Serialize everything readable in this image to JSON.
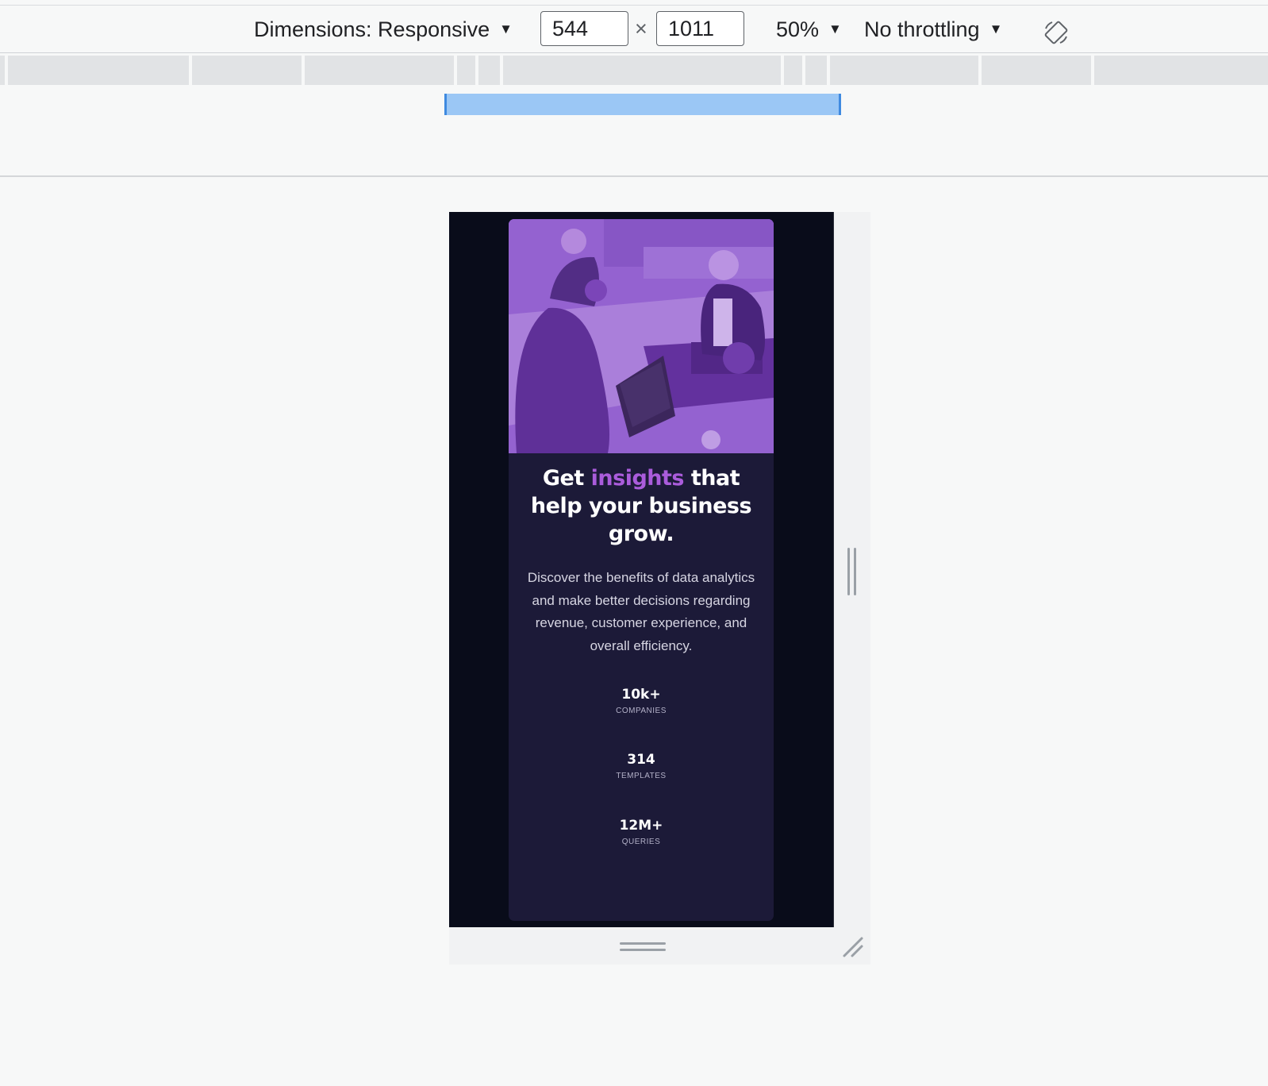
{
  "toolbar": {
    "dimensions_label": "Dimensions: Responsive",
    "width_value": "544",
    "times": "×",
    "height_value": "1011",
    "zoom_label": "50%",
    "throttling_label": "No throttling",
    "dropdown_arrow": "▼",
    "rotate_icon": "rotate-icon"
  },
  "page": {
    "headline_before": "Get ",
    "headline_accent": "insights",
    "headline_after": " that help your business grow.",
    "description": "Discover the benefits of data analytics and make better decisions regarding revenue, customer experience, and overall efficiency.",
    "stats": [
      {
        "value": "10k+",
        "label": "COMPANIES"
      },
      {
        "value": "314",
        "label": "TEMPLATES"
      },
      {
        "value": "12M+",
        "label": "QUERIES"
      }
    ]
  },
  "colors": {
    "viewport_bg": "#090c1a",
    "card_bg": "#1c1a38",
    "accent": "#aa5cdb",
    "hero_tint": "#9567d0",
    "media_bar": "#9bc7f5"
  }
}
